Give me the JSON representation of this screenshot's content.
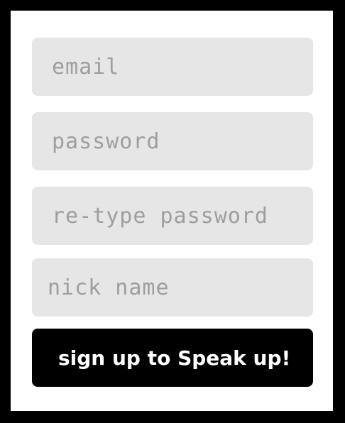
{
  "form": {
    "email_placeholder": "email",
    "password_placeholder": "password",
    "retype_password_placeholder": "re-type password",
    "nickname_placeholder": "nick name",
    "submit_label": "sign up to Speak up!"
  },
  "colors": {
    "frame": "#000000",
    "panel": "#ffffff",
    "field_background": "#e6e6e6",
    "placeholder_text": "#9e9e9e",
    "button_background": "#000000",
    "button_text": "#ffffff"
  }
}
